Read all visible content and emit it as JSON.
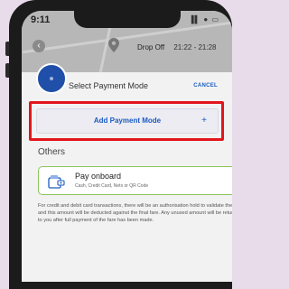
{
  "status_bar": {
    "time": "9:11",
    "icons": "▐▌ ● ▭"
  },
  "header": {
    "back_icon": "chevron-left-icon",
    "dropoff_label": "Drop Off",
    "dropoff_time": "21:22 - 21:28"
  },
  "payment_sheet": {
    "title": "Select Payment Mode",
    "cancel_label": "CANCEL",
    "add_payment_label": "Add Payment Mode",
    "add_payment_plus": "+",
    "others_title": "Others",
    "onboard": {
      "title": "Pay onboard",
      "subtitle": "Cash, Credit Card, Nets or QR Code",
      "icon": "card-wallet-icon"
    },
    "disclaimer": "For credit and debit card transactions, there will be an authorisation hold to validate the card and this amount will be deducted against the final fare. Any unused amount will be returned to you after full payment of the fare has been made."
  },
  "colors": {
    "highlight": "#e3161b",
    "accent_blue": "#1c5bc0",
    "onboard_border": "#8cc55c"
  }
}
